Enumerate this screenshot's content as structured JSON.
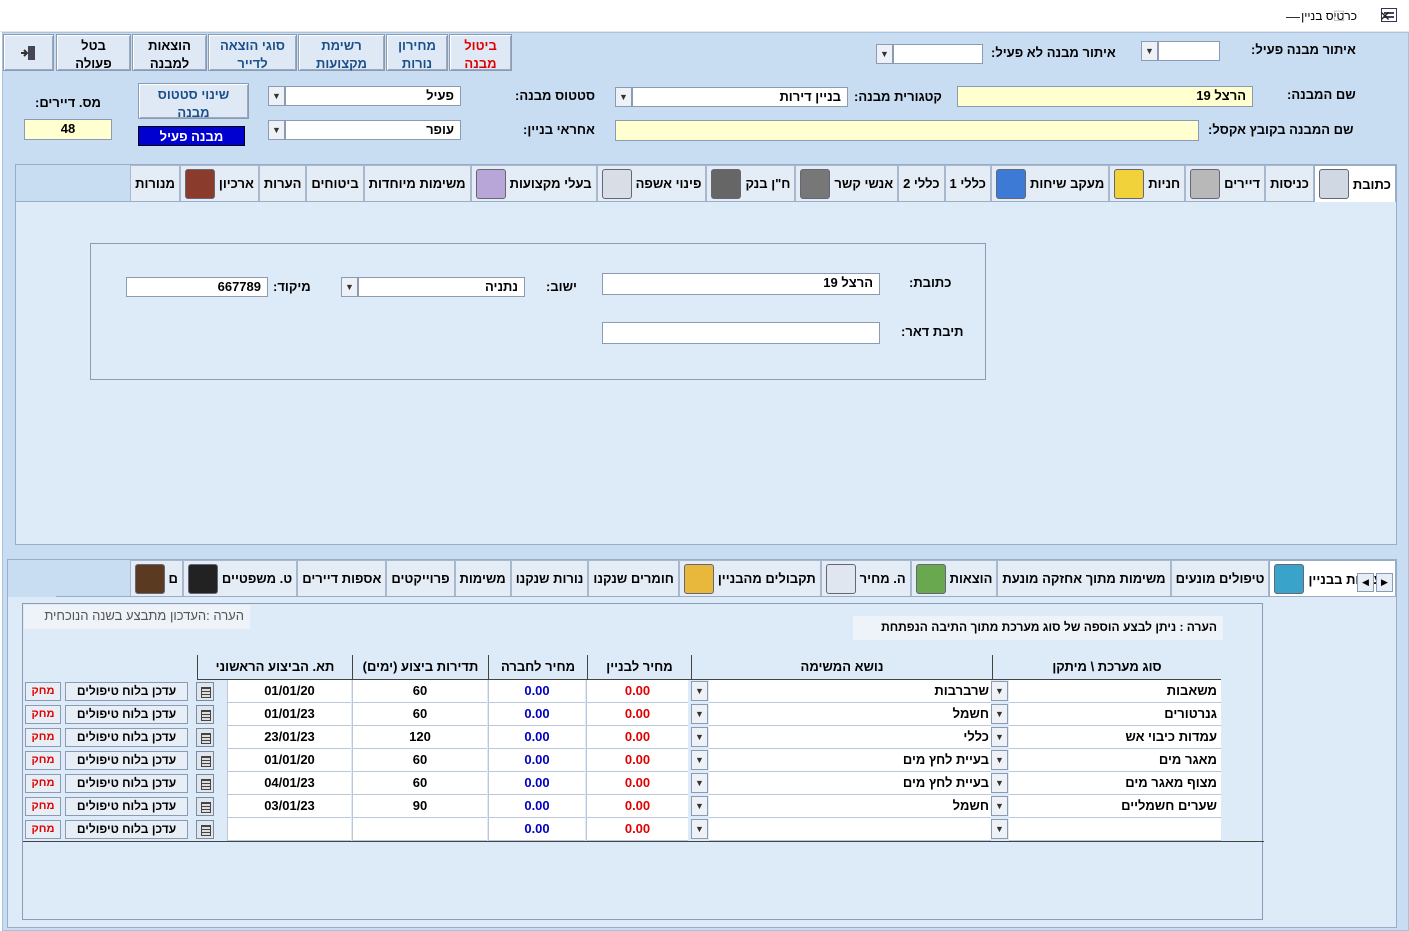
{
  "window": {
    "title": "כרטיס בניין",
    "minimize": "—",
    "maximize": "☐",
    "close": "✕"
  },
  "toolbar": {
    "cancel_building": [
      "ביטול",
      "מבנה"
    ],
    "price_lamps": [
      "מחירון",
      "נורות"
    ],
    "prof_list": [
      "רשימת",
      "מקצועות"
    ],
    "expense_types": [
      "סוגי הוצאה",
      "לדייר"
    ],
    "expenses": [
      "הוצאות",
      "למבנה"
    ],
    "cancel_action": [
      "בטל",
      "פעולה"
    ]
  },
  "search": {
    "active_label": "איתור מבנה פעיל:",
    "inactive_label": "איתור מבנה לא פעיל:"
  },
  "building": {
    "name_label": "שם המבנה:",
    "name_value": "הרצל 19",
    "category_label": "קטגורית מבנה:",
    "category_value": "בניין דירות",
    "status_label": "סטטוס מבנה:",
    "status_value": "פעיל",
    "change_status_btn": [
      "שינוי סטטוס",
      "מבנה"
    ],
    "tenants_label": "מס. דיירים:",
    "tenants_value": "48",
    "excel_name_label": "שם המבנה בקובץ אקסל:",
    "excel_name_value": "",
    "manager_label": "אחראי בניין:",
    "manager_value": "עופר",
    "active_badge": "מבנה פעיל"
  },
  "top_tabs": [
    {
      "label": "כתובת",
      "icon": "worker-icon",
      "active": true
    },
    {
      "label": "כניסות",
      "icon": "",
      "active": false
    },
    {
      "label": "דיירים",
      "icon": "tenant-face-icon",
      "active": false
    },
    {
      "label": "חניות",
      "icon": "truck-icon",
      "active": false
    },
    {
      "label": "מעקב שיחות",
      "icon": "phone-icon",
      "active": false
    },
    {
      "label": "כללי 1",
      "icon": "",
      "active": false
    },
    {
      "label": "כללי 2",
      "icon": "",
      "active": false
    },
    {
      "label": "אנשי קשר",
      "icon": "person-photo-icon",
      "active": false
    },
    {
      "label": "ח\"ן בנק",
      "icon": "safe-icon",
      "active": false
    },
    {
      "label": "פינוי אשפה",
      "icon": "vacuum-icon",
      "active": false
    },
    {
      "label": "בעלי מקצועות",
      "icon": "professional-icon",
      "active": false
    },
    {
      "label": "משימות מיוחדות",
      "icon": "",
      "active": false
    },
    {
      "label": "ביטוחים",
      "icon": "",
      "active": false
    },
    {
      "label": "הערות",
      "icon": "",
      "active": false
    },
    {
      "label": "ארכיון",
      "icon": "books-icon",
      "active": false
    },
    {
      "label": "מנורות",
      "icon": "",
      "active": false
    }
  ],
  "address": {
    "address_label": "כתובת:",
    "address_value": "הרצל 19",
    "city_label": "ישוב:",
    "city_value": "נתניה",
    "zip_label": "מיקוד:",
    "zip_value": "667789",
    "pobox_label": "תיבת דאר:",
    "pobox_value": ""
  },
  "bottom_tabs": [
    {
      "label": "מערכות בבניין",
      "icon": "system-icon",
      "active": true
    },
    {
      "label": "טיפולים מונעים",
      "icon": "",
      "active": false
    },
    {
      "label": "משימות מתוך אחזקה  מונעת",
      "icon": "",
      "active": false
    },
    {
      "label": "הוצאות",
      "icon": "money-icon",
      "active": false
    },
    {
      "label": "ה. מחיר",
      "icon": "document-icon",
      "active": false
    },
    {
      "label": "תקבולים מהבניין",
      "icon": "coins-chart-icon",
      "active": false
    },
    {
      "label": "חומרים שנקנו",
      "icon": "",
      "active": false
    },
    {
      "label": "נורות שנקנו",
      "icon": "",
      "active": false
    },
    {
      "label": "משימות",
      "icon": "",
      "active": false
    },
    {
      "label": "פרוייקטים",
      "icon": "",
      "active": false
    },
    {
      "label": "אספות דיירים",
      "icon": "",
      "active": false
    },
    {
      "label": "ט. משפטיים",
      "icon": "judge-icon",
      "active": false
    },
    {
      "label": "ם",
      "icon": "bearded-face-icon",
      "active": false
    }
  ],
  "systems": {
    "note_left": "הערה :העדכון מתבצע בשנה  הנוכחית",
    "note_right": "הערה : ניתן לבצע הוספה של סוג מערכת מתוך התיבה הנפתחת",
    "headers": {
      "system_type": "סוג  מערכת \\ מיתקן",
      "task_subject": "נושא המשימה",
      "building_price": "מחיר לבניין",
      "company_price": "מחיר לחברה",
      "frequency": "תדירות ביצוע (ימים)",
      "first_date": "תא. הביצוע הראשוני"
    },
    "update_label": "עדכן בלוח טיפולים",
    "delete_label": "מחק",
    "rows": [
      {
        "system": "משאבות",
        "task": "שרברבות",
        "bprice": "0.00",
        "cprice": "0.00",
        "freq": "60",
        "date": "01/01/20"
      },
      {
        "system": "גנרטורים",
        "task": "חשמל",
        "bprice": "0.00",
        "cprice": "0.00",
        "freq": "60",
        "date": "01/01/23"
      },
      {
        "system": "עמדות כיבוי אש",
        "task": "כללי",
        "bprice": "0.00",
        "cprice": "0.00",
        "freq": "120",
        "date": "23/01/23"
      },
      {
        "system": "מאגר מים",
        "task": "בעיית לחץ מים",
        "bprice": "0.00",
        "cprice": "0.00",
        "freq": "60",
        "date": "01/01/20"
      },
      {
        "system": "מצוף מאגר מים",
        "task": "בעיית לחץ מים",
        "bprice": "0.00",
        "cprice": "0.00",
        "freq": "60",
        "date": "04/01/23"
      },
      {
        "system": "שערים חשמליים",
        "task": "חשמל",
        "bprice": "0.00",
        "cprice": "0.00",
        "freq": "90",
        "date": "03/01/23"
      },
      {
        "system": "",
        "task": "",
        "bprice": "0.00",
        "cprice": "0.00",
        "freq": "",
        "date": ""
      }
    ]
  },
  "colors": {
    "form_bg": "#c8dcf2",
    "panel_bg": "#ddeaf8",
    "yellow_field": "#ffffd0",
    "red_text": "#e00000",
    "blue_text": "#0000c0",
    "badge_bg": "#0000d0"
  }
}
